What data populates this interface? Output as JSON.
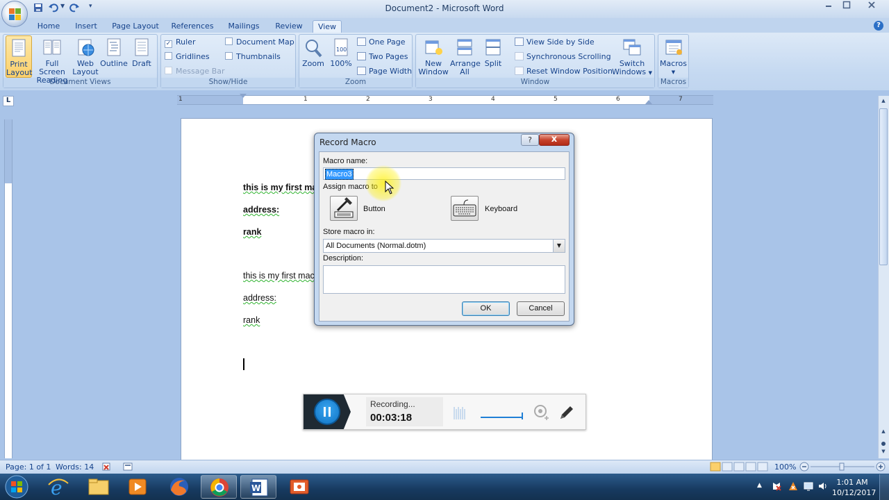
{
  "window": {
    "title": "Document2 - Microsoft Word",
    "controls": [
      "minimize",
      "maximize",
      "close"
    ]
  },
  "quick_access": [
    "save-icon",
    "undo-icon",
    "redo-icon",
    "customize-icon"
  ],
  "tabs": [
    {
      "label": "Home",
      "active": false
    },
    {
      "label": "Insert",
      "active": false
    },
    {
      "label": "Page Layout",
      "active": false
    },
    {
      "label": "References",
      "active": false
    },
    {
      "label": "Mailings",
      "active": false
    },
    {
      "label": "Review",
      "active": false
    },
    {
      "label": "View",
      "active": true
    }
  ],
  "ribbon": {
    "document_views": {
      "label": "Document Views",
      "buttons": [
        {
          "line1": "Print",
          "line2": "Layout",
          "selected": true
        },
        {
          "line1": "Full Screen",
          "line2": "Reading"
        },
        {
          "line1": "Web",
          "line2": "Layout"
        },
        {
          "line1": "Outline",
          "line2": ""
        },
        {
          "line1": "Draft",
          "line2": ""
        }
      ]
    },
    "show_hide": {
      "label": "Show/Hide",
      "items": [
        {
          "label": "Ruler",
          "checked": true,
          "enabled": true
        },
        {
          "label": "Gridlines",
          "checked": false,
          "enabled": true
        },
        {
          "label": "Message Bar",
          "checked": false,
          "enabled": false
        },
        {
          "label": "Document Map",
          "checked": false,
          "enabled": true
        },
        {
          "label": "Thumbnails",
          "checked": false,
          "enabled": true
        }
      ]
    },
    "zoom": {
      "label": "Zoom",
      "zoom_label": "Zoom",
      "percent_label": "100%",
      "one_page": "One Page",
      "two_pages": "Two Pages",
      "page_width": "Page Width"
    },
    "window_group": {
      "label": "Window",
      "new_window": [
        "New",
        "Window"
      ],
      "arrange_all": [
        "Arrange",
        "All"
      ],
      "split": "Split",
      "view_side_by_side": "View Side by Side",
      "synchronous_scrolling": "Synchronous Scrolling",
      "reset_window_position": "Reset Window Position",
      "switch_windows": [
        "Switch",
        "Windows"
      ]
    },
    "macros": {
      "label": "Macros",
      "button": "Macros"
    }
  },
  "ruler": {
    "numbers": [
      "1",
      "1",
      "2",
      "3",
      "4",
      "5",
      "6",
      "7"
    ]
  },
  "document": {
    "lines": [
      {
        "text": "this is my first mac",
        "bold": true
      },
      {
        "text": "address:",
        "bold": true
      },
      {
        "text": "rank",
        "bold": true
      },
      {
        "text": "this is my first mac",
        "bold": false
      },
      {
        "text": "address:",
        "bold": false
      },
      {
        "text": "rank",
        "bold": false
      }
    ]
  },
  "dialog": {
    "title": "Record Macro",
    "help_label": "?",
    "close_label": "x",
    "macro_name_label": "Macro name:",
    "macro_name_value": "Macro3",
    "assign_label": "Assign macro to",
    "button_label": "Button",
    "keyboard_label": "Keyboard",
    "store_label": "Store macro in:",
    "store_value": "All Documents (Normal.dotm)",
    "description_label": "Description:",
    "description_value": "",
    "ok_label": "OK",
    "cancel_label": "Cancel"
  },
  "recorder": {
    "status": "Recording...",
    "time": "00:03:18"
  },
  "statusbar": {
    "page": "Page: 1 of 1",
    "words": "Words: 14",
    "zoom": "100%"
  },
  "clock": {
    "time": "1:01 AM",
    "date": "10/12/2017"
  },
  "colors": {
    "ribbon_bg": "#c5d9f1",
    "accent": "#15428b",
    "selection": "#3399ff",
    "taskbar": "#173a60"
  }
}
